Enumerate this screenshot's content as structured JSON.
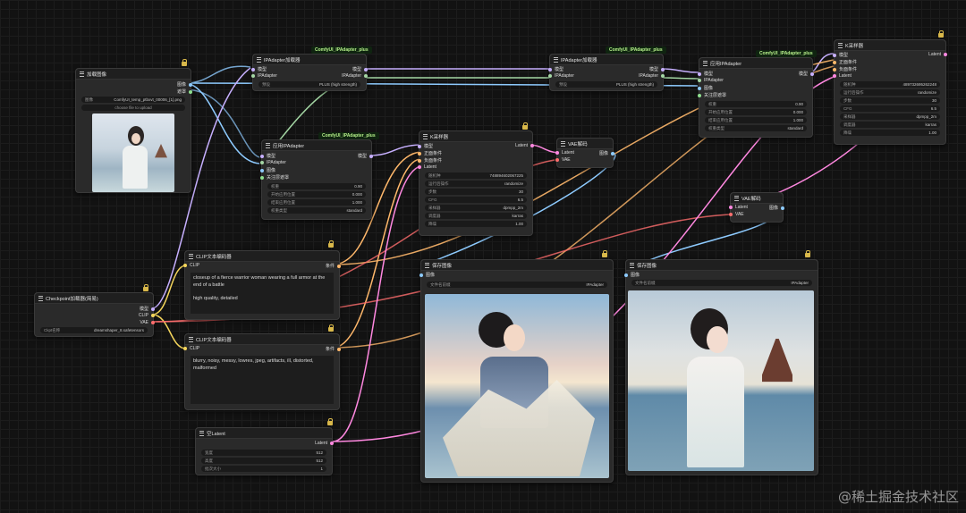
{
  "colors": {
    "model": "#c7b0ff",
    "clip": "#f5d65c",
    "conditioning": "#ffb86b",
    "vae": "#ff6e6e",
    "latent": "#ff88e0",
    "image": "#8ecbff",
    "ipadapter": "#a4d7a4",
    "tag_bg": "#0f2410",
    "tag_fg": "#b6f08a"
  },
  "nodes": {
    "load_image": {
      "title": "加载图像",
      "out_image": "图像",
      "out_mask": "遮罩",
      "file_label": "图像",
      "file_value": "ComfyUI_temp_ptbxvt_00006_[1].png",
      "upload": "choose file to upload"
    },
    "ipa_loader_1": {
      "tag": "ComfyUI_IPAdapter_plus",
      "title": "IPAdapter加载器",
      "in_model": "模型",
      "in_ipadapter": "IPAdapter",
      "out_model": "模型",
      "out_ipadapter": "IPAdapter",
      "preset_label": "预设",
      "preset_value": "PLUS (high strength)"
    },
    "ipa_loader_2": {
      "tag": "ComfyUI_IPAdapter_plus",
      "title": "IPAdapter加载器",
      "in_model": "模型",
      "in_ipadapter": "IPAdapter",
      "out_model": "模型",
      "out_ipadapter": "IPAdapter",
      "preset_label": "预设",
      "preset_value": "PLUS (high strength)"
    },
    "apply_ipa_1": {
      "tag": "ComfyUI_IPAdapter_plus",
      "title": "应用IPAdapter",
      "in_model": "模型",
      "in_ipadapter": "IPAdapter",
      "in_image": "图像",
      "in_mask": "关注层遮罩",
      "out_model": "模型",
      "widgets": [
        {
          "label": "权重",
          "value": "0.90"
        },
        {
          "label": "开始应用位置",
          "value": "0.000"
        },
        {
          "label": "结束应用位置",
          "value": "1.000"
        },
        {
          "label": "权重类型",
          "value": "standard"
        }
      ]
    },
    "apply_ipa_2": {
      "tag": "ComfyUI_IPAdapter_plus",
      "title": "应用IPAdapter",
      "in_model": "模型",
      "in_ipadapter": "IPAdapter",
      "in_image": "图像",
      "in_mask": "关注层遮罩",
      "out_model": "模型",
      "widgets": [
        {
          "label": "权重",
          "value": "0.90"
        },
        {
          "label": "开始应用位置",
          "value": "0.000"
        },
        {
          "label": "结束应用位置",
          "value": "1.000"
        },
        {
          "label": "权重类型",
          "value": "standard"
        }
      ]
    },
    "ksampler_1": {
      "title": "K采样器",
      "in_model": "模型",
      "in_pos": "正面条件",
      "in_neg": "负面条件",
      "in_latent": "Latent",
      "out_latent": "Latent",
      "widgets": [
        {
          "label": "随机种",
          "value": "748894602067225"
        },
        {
          "label": "运行后操作",
          "value": "randomize"
        },
        {
          "label": "步数",
          "value": "30"
        },
        {
          "label": "CFG",
          "value": "6.5"
        },
        {
          "label": "采样器",
          "value": "dpmpp_2m"
        },
        {
          "label": "调度器",
          "value": "karras"
        },
        {
          "label": "降噪",
          "value": "1.00"
        }
      ]
    },
    "ksampler_2": {
      "title": "K采样器",
      "in_model": "模型",
      "in_pos": "正面条件",
      "in_neg": "负面条件",
      "in_latent": "Latent",
      "out_latent": "Latent",
      "widgets": [
        {
          "label": "随机种",
          "value": "489732695262248"
        },
        {
          "label": "运行后操作",
          "value": "randomize"
        },
        {
          "label": "步数",
          "value": "30"
        },
        {
          "label": "CFG",
          "value": "6.5"
        },
        {
          "label": "采样器",
          "value": "dpmpp_2m"
        },
        {
          "label": "调度器",
          "value": "karras"
        },
        {
          "label": "降噪",
          "value": "1.00"
        }
      ]
    },
    "vae_decode_1": {
      "title": "VAE解码",
      "in_latent": "Latent",
      "in_vae": "VAE",
      "out_image": "图像"
    },
    "vae_decode_2": {
      "title": "VAE解码",
      "in_latent": "Latent",
      "in_vae": "VAE",
      "out_image": "图像"
    },
    "clip_pos": {
      "title": "CLIP文本编码器",
      "in_clip": "CLIP",
      "out_cond": "条件",
      "text": "closeup of a fierce warrior woman wearing a full armor at the end of a battle\n\nhigh quality, detailed"
    },
    "clip_neg": {
      "title": "CLIP文本编码器",
      "in_clip": "CLIP",
      "out_cond": "条件",
      "text": "blurry, noisy, messy, lowres, jpeg, artifacts, ill, distorted, malformed"
    },
    "checkpoint": {
      "title": "Checkpoint加载器(简易)",
      "out_model": "模型",
      "out_clip": "CLIP",
      "out_vae": "VAE",
      "ckpt_label": "Ckpt名称",
      "ckpt_value": "dreamshaper_8.safetensors"
    },
    "empty_latent": {
      "title": "空Latent",
      "out_latent": "Latent",
      "widgets": [
        {
          "label": "宽度",
          "value": "512"
        },
        {
          "label": "高度",
          "value": "512"
        },
        {
          "label": "批次大小",
          "value": "1"
        }
      ]
    },
    "save_1": {
      "title": "保存图像",
      "in_image": "图像",
      "prefix_label": "文件名前缀",
      "prefix_value": "IPAdapter"
    },
    "save_2": {
      "title": "保存图像",
      "in_image": "图像",
      "prefix_label": "文件名前缀",
      "prefix_value": "IPAdapter"
    }
  },
  "watermark": "@稀土掘金技术社区"
}
